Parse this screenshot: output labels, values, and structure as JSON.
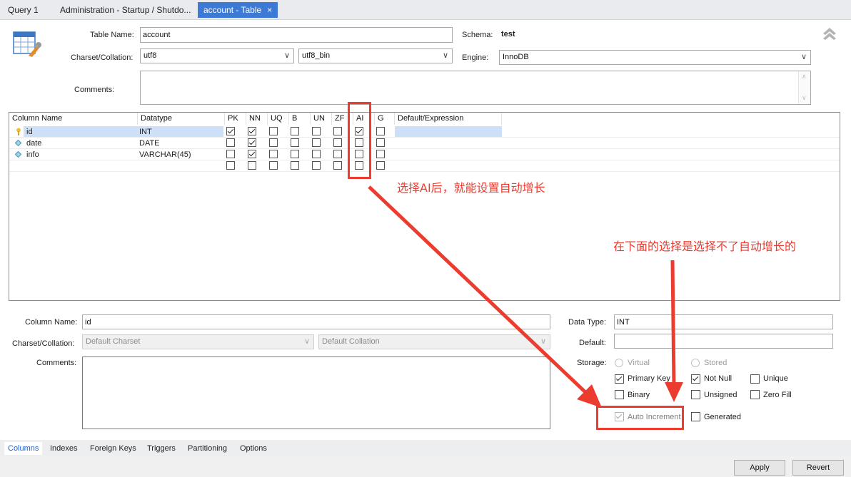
{
  "tabs": [
    {
      "label": "Query 1"
    },
    {
      "label": "Administration - Startup / Shutdo..."
    },
    {
      "label": "account - Table",
      "close": "×"
    }
  ],
  "table": {
    "name_label": "Table Name:",
    "name": "account",
    "schema_label": "Schema:",
    "schema": "test",
    "charset_label": "Charset/Collation:",
    "charset": "utf8",
    "collation": "utf8_bin",
    "engine_label": "Engine:",
    "engine": "InnoDB",
    "comments_label": "Comments:"
  },
  "grid": {
    "headers": [
      "Column Name",
      "Datatype",
      "PK",
      "NN",
      "UQ",
      "B",
      "UN",
      "ZF",
      "AI",
      "G",
      "Default/Expression"
    ],
    "rows": [
      {
        "name": "id",
        "datatype": "INT",
        "icon": "key-icon",
        "flags": {
          "pk": true,
          "nn": true,
          "uq": false,
          "b": false,
          "un": false,
          "zf": false,
          "ai": true,
          "g": false
        }
      },
      {
        "name": "date",
        "datatype": "DATE",
        "icon": "diamond-icon",
        "flags": {
          "pk": false,
          "nn": true,
          "uq": false,
          "b": false,
          "un": false,
          "zf": false,
          "ai": false,
          "g": false
        }
      },
      {
        "name": "info",
        "datatype": "VARCHAR(45)",
        "icon": "diamond-icon",
        "flags": {
          "pk": false,
          "nn": true,
          "uq": false,
          "b": false,
          "un": false,
          "zf": false,
          "ai": false,
          "g": false
        }
      }
    ]
  },
  "details": {
    "column_name_label": "Column Name:",
    "column_name": "id",
    "charset_label": "Charset/Collation:",
    "charset": "Default Charset",
    "collation": "Default Collation",
    "comments_label": "Comments:",
    "data_type_label": "Data Type:",
    "data_type": "INT",
    "default_label": "Default:",
    "storage_label": "Storage:",
    "virtual": "Virtual",
    "stored": "Stored",
    "primary_key": "Primary Key",
    "not_null": "Not Null",
    "unique": "Unique",
    "binary": "Binary",
    "unsigned": "Unsigned",
    "zero_fill": "Zero Fill",
    "auto_increment": "Auto Increment",
    "generated": "Generated"
  },
  "bottom_tabs": [
    "Columns",
    "Indexes",
    "Foreign Keys",
    "Triggers",
    "Partitioning",
    "Options"
  ],
  "buttons": {
    "apply": "Apply",
    "revert": "Revert"
  },
  "annotations": {
    "note1": "选择AI后，就能设置自动增长",
    "note2": "在下面的选择是选择不了自动增长的"
  },
  "colors": {
    "accent": "#3c7ad6",
    "annotation": "#ec3b2f",
    "selection": "#cde0f7"
  }
}
